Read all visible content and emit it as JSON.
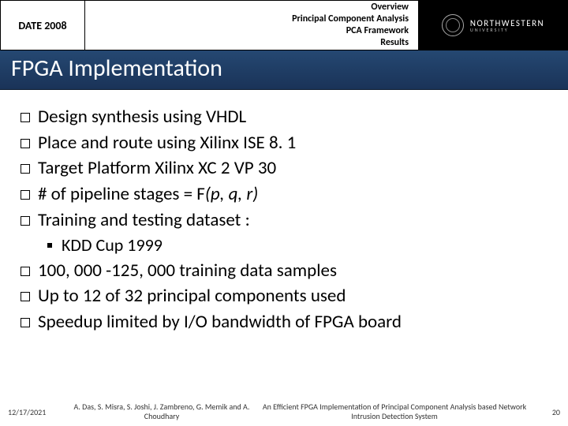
{
  "header": {
    "conference": "DATE 2008",
    "sections": [
      "Overview",
      "Principal Component Analysis",
      "PCA Framework",
      "Results"
    ],
    "university_top": "NORTHWESTERN",
    "university_bot": "UNIVERSITY"
  },
  "title": "FPGA Implementation",
  "bullets": [
    {
      "level": 1,
      "text": "Design synthesis using VHDL"
    },
    {
      "level": 1,
      "text": "Place and route using Xilinx ISE 8. 1"
    },
    {
      "level": 1,
      "text": "Target Platform Xilinx XC 2 VP 30"
    },
    {
      "level": 1,
      "prefix": "# of pipeline stages = F",
      "italic": "(p, q, r)"
    },
    {
      "level": 1,
      "text": "Training and testing dataset :"
    },
    {
      "level": 2,
      "text": "KDD Cup 1999"
    },
    {
      "level": 1,
      "text": "100, 000 -125, 000 training data samples"
    },
    {
      "level": 1,
      "text": "Up to 12 of 32 principal components used"
    },
    {
      "level": 1,
      "text": "Speedup limited by I/O bandwidth of FPGA board"
    }
  ],
  "footer": {
    "date": "12/17/2021",
    "authors": "A. Das, S. Misra, S. Joshi, J. Zambreno, G. Memik and A. Choudhary",
    "paper_title": "An Efficient FPGA Implementation of Principal Component Analysis based Network Intrusion Detection System",
    "page": "20"
  }
}
